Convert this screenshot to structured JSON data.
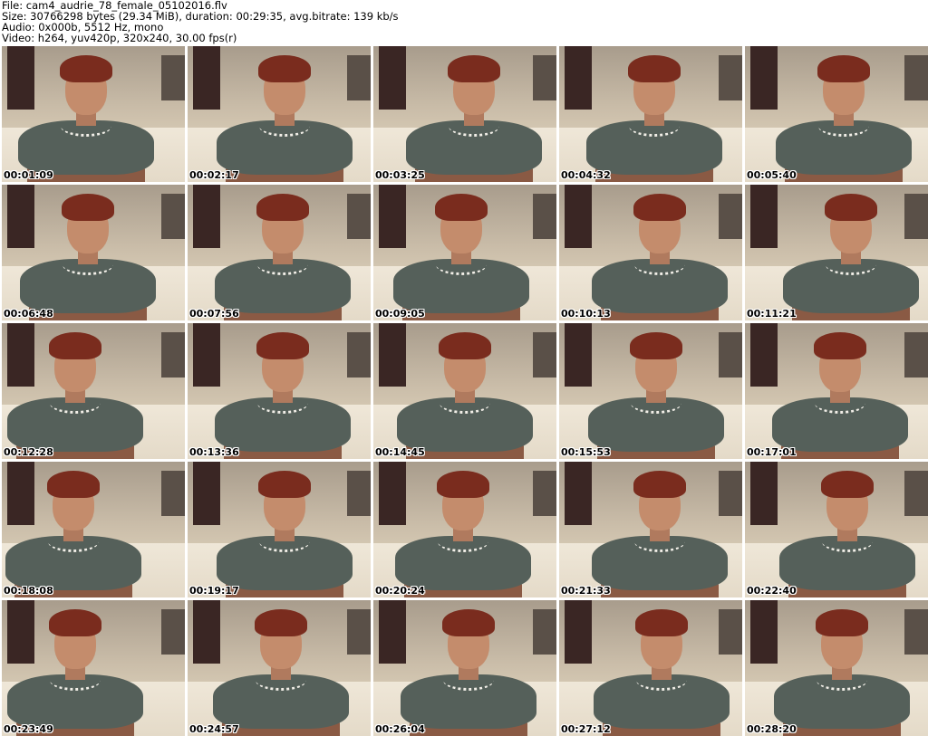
{
  "header": {
    "file": "File: cam4_audrie_78_female_05102016.flv",
    "size": "Size: 30766298 bytes (29.34 MiB), duration: 00:29:35, avg.bitrate: 139 kb/s",
    "audio": "Audio: 0x000b, 5512 Hz, mono",
    "video": "Video: h264, yuv420p, 320x240, 30.00 fps(r)"
  },
  "thumbnails": [
    "00:01:09",
    "00:02:17",
    "00:03:25",
    "00:04:32",
    "00:05:40",
    "00:06:48",
    "00:07:56",
    "00:09:05",
    "00:10:13",
    "00:11:21",
    "00:12:28",
    "00:13:36",
    "00:14:45",
    "00:15:53",
    "00:17:01",
    "00:18:08",
    "00:19:17",
    "00:20:24",
    "00:21:33",
    "00:22:40",
    "00:23:49",
    "00:24:57",
    "00:26:04",
    "00:27:12",
    "00:28:20"
  ]
}
